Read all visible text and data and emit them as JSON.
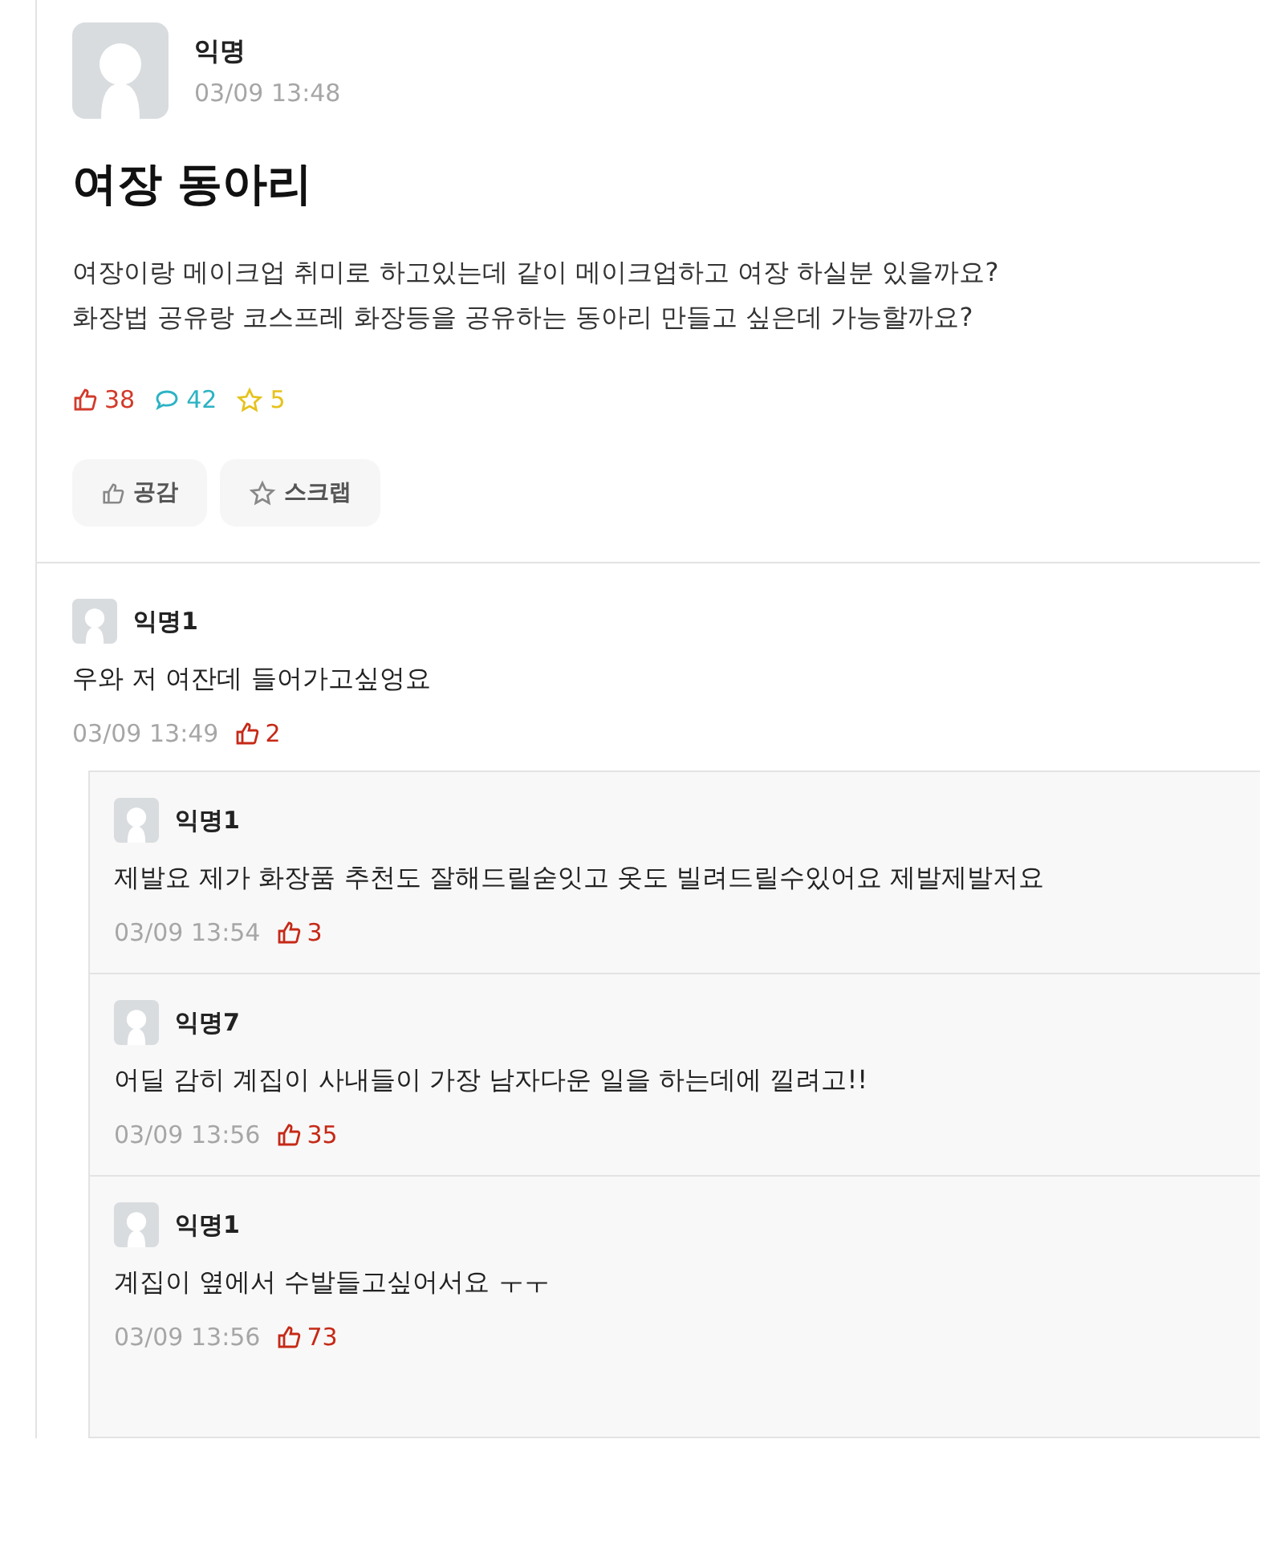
{
  "post": {
    "author": "익명",
    "time": "03/09 13:48",
    "title": "여장 동아리",
    "body": "여장이랑 메이크업 취미로 하고있는데 같이 메이크업하고 여장 하실분 있을까요?\n화장법 공유랑 코스프레 화장등을 공유하는 동아리 만들고 싶은데 가능할까요?",
    "stats": [
      {
        "kind": "like",
        "value": "38"
      },
      {
        "kind": "comment",
        "value": "42"
      },
      {
        "kind": "scrap",
        "value": "5"
      }
    ],
    "buttons": [
      {
        "kind": "like",
        "label": "공감"
      },
      {
        "kind": "scrap",
        "label": "스크랩"
      }
    ]
  },
  "comments": [
    {
      "author": "익명1",
      "text": "우와 저 여잔데 들어가고싶엉요",
      "time": "03/09 13:49",
      "likes": "2",
      "replies": [
        {
          "author": "익명1",
          "text": "제발요 제가 화장품 추천도 잘해드릴숟잇고 옷도 빌려드릴수있어요 제발제발저요",
          "time": "03/09 13:54",
          "likes": "3"
        },
        {
          "author": "익명7",
          "text": "어딜 감히 계집이 사내들이 가장 남자다운 일을 하는데에 낄려고!!",
          "time": "03/09 13:56",
          "likes": "35"
        },
        {
          "author": "익명1",
          "text": "계집이 옆에서 수발들고싶어서요 ㅜㅜ",
          "time": "03/09 13:56",
          "likes": "73"
        }
      ]
    }
  ]
}
